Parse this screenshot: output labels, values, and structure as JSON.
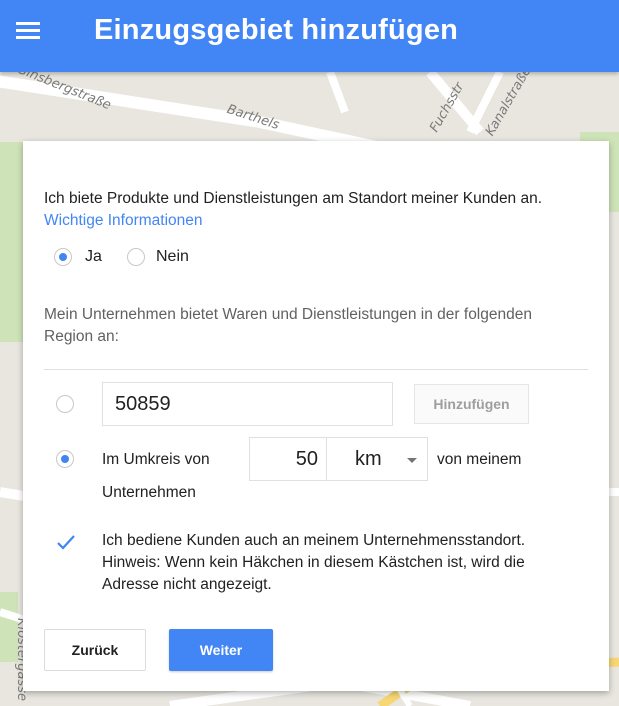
{
  "header": {
    "title": "Einzugsgebiet hinzufügen",
    "color": "#4285f4"
  },
  "map": {
    "labels": [
      "Ginsbergstraße",
      "Barthels",
      "Fuchsstr",
      "Kanalstraße",
      "Klostergasse"
    ]
  },
  "dialog": {
    "intro": "Ich biete Produkte und Dienstleistungen am Standort meiner Kunden an.",
    "info_link": "Wichtige Informationen",
    "yes_label": "Ja",
    "no_label": "Nein",
    "yes_selected": true,
    "region_text": "Mein Unternehmen bietet Waren und Dienstleistungen in der folgenden Region an:",
    "zip_value": "50859",
    "add_button": "Hinzufügen",
    "zip_selected": false,
    "radius_selected": true,
    "radius_prefix": "Im Umkreis von",
    "radius_value": "50",
    "radius_unit": "km",
    "radius_suffix_1": "von meinem",
    "radius_suffix_2": "Unternehmen",
    "checkbox_checked": true,
    "checkbox_text": "Ich bediene Kunden auch an meinem Unternehmensstandort. Hinweis: Wenn kein Häkchen in diesem Kästchen ist, wird die Adresse nicht angezeigt.",
    "back_button": "Zurück",
    "next_button": "Weiter"
  }
}
